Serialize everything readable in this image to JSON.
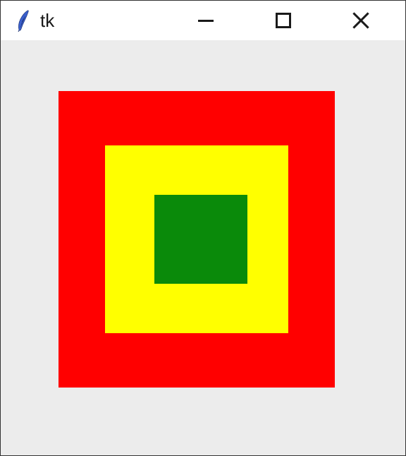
{
  "window": {
    "title": "tk",
    "icon_name": "tk-feather-icon",
    "controls": {
      "minimize": "Minimize",
      "maximize": "Maximize",
      "close": "Close"
    }
  },
  "canvas": {
    "background": "#ececec",
    "rects": [
      {
        "name": "outer",
        "fill": "#ff0000"
      },
      {
        "name": "middle",
        "fill": "#ffff00"
      },
      {
        "name": "inner",
        "fill": "#0a8a0a"
      }
    ]
  }
}
